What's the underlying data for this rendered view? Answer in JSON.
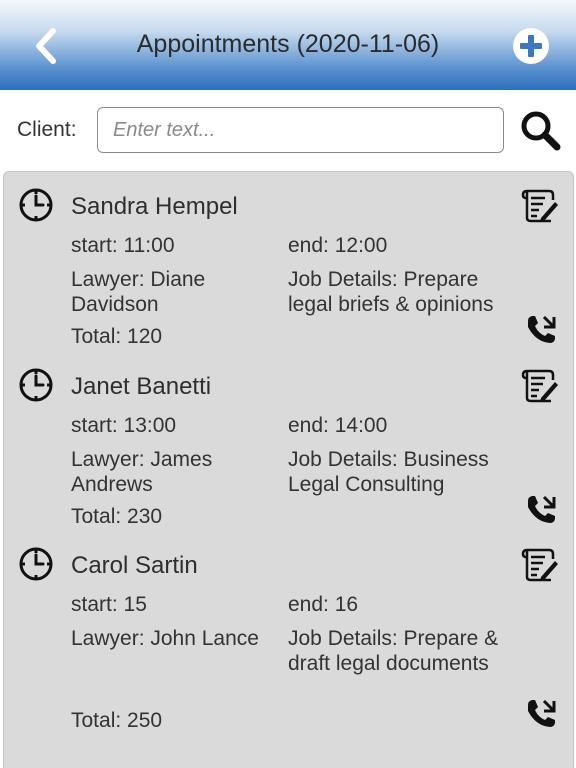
{
  "header": {
    "title": "Appointments (2020-11-06)"
  },
  "search": {
    "label": "Client:",
    "placeholder": "Enter text...",
    "value": ""
  },
  "appointments": [
    {
      "name": "Sandra Hempel",
      "start": "start: 11:00",
      "end": "end: 12:00",
      "lawyer": "Lawyer: Diane Davidson",
      "job": "Job Details: Prepare legal briefs & opinions",
      "total": "Total: 120"
    },
    {
      "name": "Janet Banetti",
      "start": "start: 13:00",
      "end": "end: 14:00",
      "lawyer": "Lawyer: James Andrews",
      "job": "Job Details: Business Legal Consulting",
      "total": "Total: 230"
    },
    {
      "name": "Carol Sartin",
      "start": "start: 15",
      "end": "end: 16",
      "lawyer": "Lawyer: John Lance",
      "job": "Job Details: Prepare & draft legal documents",
      "total": "Total: 250"
    }
  ],
  "icons": {
    "back": "chevron-left-icon",
    "add": "plus-circle-icon",
    "search": "search-icon",
    "clock": "clock-icon",
    "edit": "edit-note-icon",
    "call": "phone-call-icon"
  },
  "colors": {
    "header_top": "#f4f8fc",
    "header_bottom": "#2e6fba",
    "add_icon": "#3b78c4",
    "list_background": "#dadada"
  }
}
